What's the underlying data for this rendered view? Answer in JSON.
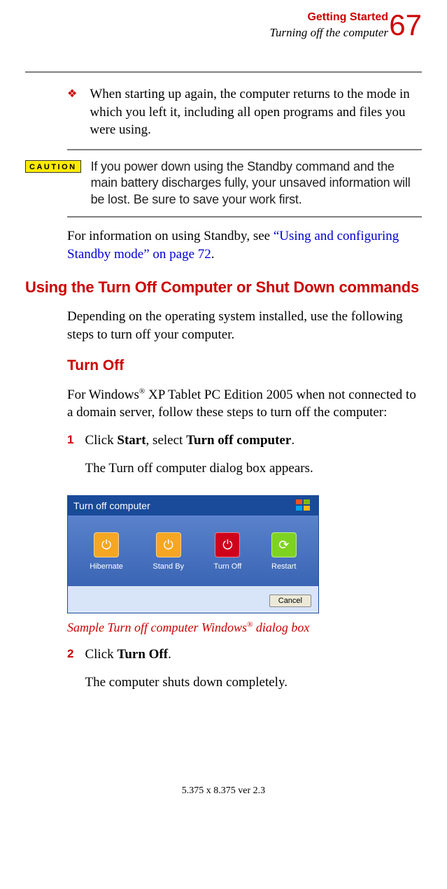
{
  "header": {
    "chapter": "Getting Started",
    "subchapter": "Turning off the computer",
    "page_number": "67"
  },
  "bullet1": "When starting up again, the computer returns to the mode in which you left it, including all open programs and files you were using.",
  "caution": {
    "label": "CAUTION",
    "text": "If you power down using the Standby command and the main battery discharges fully, your unsaved information will be lost. Be sure to save your work first."
  },
  "para_link": {
    "before": "For information on using Standby, see ",
    "link": "“Using and configuring Standby mode” on page 72",
    "after": "."
  },
  "h1": "Using the Turn Off Computer or Shut Down commands",
  "para2": "Depending on the operating system installed, use the following steps to turn off your computer.",
  "h2": "Turn Off",
  "para3": {
    "p1": "For Windows",
    "reg": "®",
    "p2": " XP Tablet PC Edition 2005 when not connected to a domain server, follow these steps to turn off the computer:"
  },
  "step1": {
    "n": "1",
    "a": "Click ",
    "b": "Start",
    "c": ", select ",
    "d": "Turn off computer",
    "e": ".",
    "after": "The Turn off computer dialog box appears."
  },
  "dialog": {
    "title": "Turn off computer",
    "hibernate": "Hibernate",
    "standby": "Stand By",
    "turnoff": "Turn Off",
    "restart": "Restart",
    "cancel": "Cancel"
  },
  "caption": {
    "a": "Sample Turn off computer Windows",
    "reg": "®",
    "b": " dialog box"
  },
  "step2": {
    "n": "2",
    "a": "Click ",
    "b": "Turn Off",
    "c": ".",
    "after": "The computer shuts down completely."
  },
  "footer": "5.375 x 8.375 ver 2.3"
}
